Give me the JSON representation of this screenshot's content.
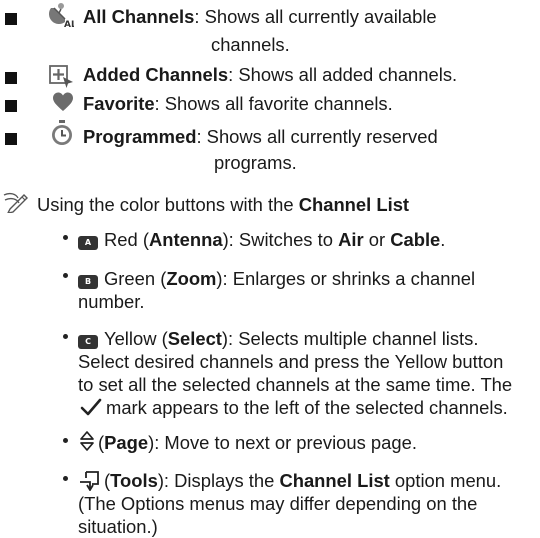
{
  "modes": [
    {
      "icon": "all-channels-icon",
      "name": "All Channels",
      "desc_line1": ": Shows all currently available",
      "desc_line2": "channels."
    },
    {
      "icon": "added-channels-icon",
      "name": "Added Channels",
      "desc_line1": ": Shows all added channels."
    },
    {
      "icon": "heart-icon",
      "name": "Favorite",
      "desc_line1": ": Shows all favorite channels."
    },
    {
      "icon": "timer-icon",
      "name": "Programmed",
      "desc_line1": ": Shows all currently reserved",
      "desc_line2": "programs."
    }
  ],
  "note": {
    "icon": "note-pencil-icon",
    "text": "Using the color buttons with the ",
    "bold": "Channel List"
  },
  "buttons": {
    "red": {
      "key": "A",
      "color_word": "Red (",
      "label": "Antenna",
      "mid": "): Switches to ",
      "opt1": "Air",
      "or": " or ",
      "opt2": "Cable",
      "end": "."
    },
    "green": {
      "key": "B",
      "color_word": "Green (",
      "label": "Zoom",
      "rest_line1": "): Enlarges or shrinks a channel",
      "line2": "number."
    },
    "yellow": {
      "key": "C",
      "color_word": "Yellow (",
      "label": "Select",
      "rest_line1": "): Selects multiple channel lists.",
      "line2": "Select desired channels and press the Yellow button",
      "line3": "to set all the selected channels at the same time. The",
      "line4": "mark appears to the left of the selected channels."
    },
    "page": {
      "open": "(",
      "label": "Page",
      "rest": "): Move to next or previous page."
    },
    "tools": {
      "open": "(",
      "label": "Tools",
      "mid": "): Displays the ",
      "bold2": "Channel List",
      "end": " option menu.",
      "line2": "(The Options menus may differ depending on the",
      "line3": "situation.)"
    }
  }
}
